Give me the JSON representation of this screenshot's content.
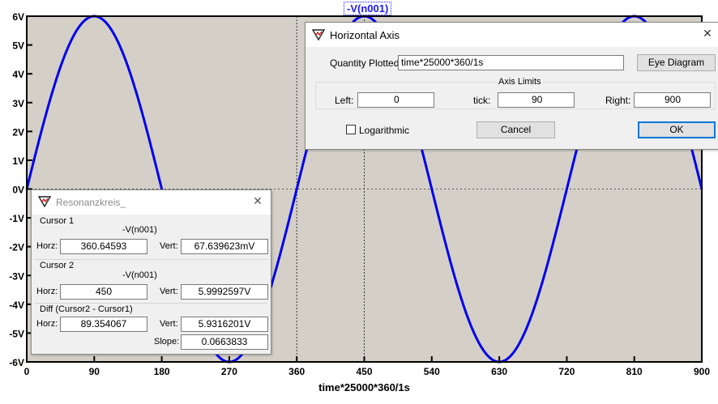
{
  "plot": {
    "trace_label": "-V(n001)",
    "xlabel": "time*25000*360/1s",
    "colors": {
      "background": "#d4d0c8",
      "trace": "#0000ee",
      "grid": "#555555",
      "axis_text": "#000000"
    }
  },
  "chart_data": {
    "type": "line",
    "title": "-V(n001)",
    "xlabel": "time*25000*360/1s",
    "ylabel": "",
    "xlim": [
      0,
      900
    ],
    "ylim": [
      -6,
      6
    ],
    "x_ticks": [
      0,
      90,
      180,
      270,
      360,
      450,
      540,
      630,
      720,
      810,
      900
    ],
    "x_tick_labels": [
      "0",
      "90",
      "180",
      "270",
      "360",
      "450",
      "540",
      "630",
      "720",
      "810",
      "900"
    ],
    "y_ticks": [
      6,
      5,
      4,
      3,
      2,
      1,
      0,
      -1,
      -2,
      -3,
      -4,
      -5,
      -6
    ],
    "y_tick_labels": [
      "6V",
      "5V",
      "4V",
      "3V",
      "2V",
      "1V",
      "0V",
      "-1V",
      "-2V",
      "-3V",
      "-4V",
      "-5V",
      "-6V"
    ],
    "cursor_x": [
      360,
      450
    ],
    "series": [
      {
        "name": "-V(n001)",
        "x": [
          0,
          45,
          90,
          135,
          180,
          225,
          270,
          315,
          360,
          405,
          450,
          495,
          540,
          585,
          630,
          675,
          720,
          765,
          810,
          855,
          900
        ],
        "y": [
          0,
          4.24,
          6,
          4.24,
          0,
          -4.24,
          -6,
          -4.24,
          0,
          4.24,
          6,
          4.24,
          0,
          -4.24,
          -6,
          -4.24,
          0,
          4.24,
          6,
          4.24,
          0
        ]
      }
    ]
  },
  "horizontal_axis_dialog": {
    "title": "Horizontal Axis",
    "quantity_label": "Quantity Plotted:",
    "quantity_value": "time*25000*360/1s",
    "eye_diagram_button": "Eye Diagram",
    "axis_limits_label": "Axis Limits",
    "left_label": "Left:",
    "left_value": "0",
    "tick_label": "tick:",
    "tick_value": "90",
    "right_label": "Right:",
    "right_value": "900",
    "logarithmic_label": "Logarithmic",
    "logarithmic_checked": false,
    "cancel_button": "Cancel",
    "ok_button": "OK",
    "close_glyph": "✕",
    "icon": "ltspice-logo-icon"
  },
  "cursor_dialog": {
    "title": "Resonanzkreis_",
    "close_glyph": "✕",
    "icon": "ltspice-logo-icon",
    "cursor1": {
      "heading": "Cursor 1",
      "trace": "-V(n001)",
      "horz_label": "Horz:",
      "horz_value": "360.64593",
      "vert_label": "Vert:",
      "vert_value": "67.639623mV"
    },
    "cursor2": {
      "heading": "Cursor 2",
      "trace": "-V(n001)",
      "horz_label": "Horz:",
      "horz_value": "450",
      "vert_label": "Vert:",
      "vert_value": "5.9992597V"
    },
    "diff": {
      "heading": "Diff (Cursor2 - Cursor1)",
      "horz_label": "Horz:",
      "horz_value": "89.354067",
      "vert_label": "Vert:",
      "vert_value": "5.9316201V",
      "slope_label": "Slope:",
      "slope_value": "0.0663833"
    }
  }
}
